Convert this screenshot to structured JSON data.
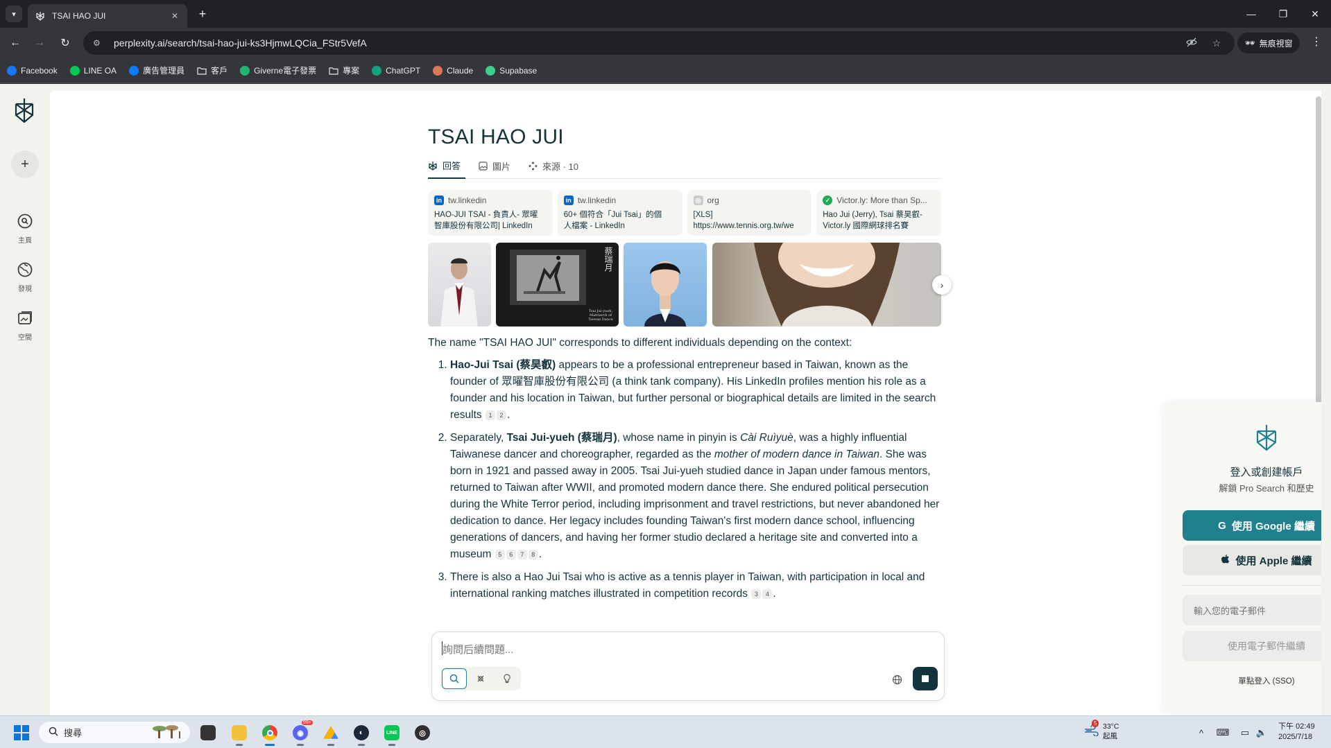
{
  "browser": {
    "tab_title": "TSAI HAO JUI",
    "url": "perplexity.ai/search/tsai-hao-jui-ks3HjmwLQCia_FStr5VefA",
    "profile_label": "無痕視窗",
    "icons": [
      "tab-search-icon",
      "close-icon",
      "new-tab-icon",
      "minimize-icon",
      "restore-icon",
      "back-icon",
      "forward-icon",
      "reload-icon",
      "site-info-icon",
      "eye-off-icon",
      "star-icon",
      "incognito-icon",
      "more-vert-icon"
    ]
  },
  "bookmarks": [
    {
      "label": "Facebook",
      "icon": "facebook-icon",
      "color": "#1877f2"
    },
    {
      "label": "LINE OA",
      "icon": "line-icon",
      "color": "#06c755"
    },
    {
      "label": "廣告管理員",
      "icon": "meta-icon",
      "color": "#0a7cff"
    },
    {
      "label": "客戶",
      "icon": "folder-icon",
      "color": "#e8eaed"
    },
    {
      "label": "Giverne電子發票",
      "icon": "giverne-icon",
      "color": "#21b573"
    },
    {
      "label": "專案",
      "icon": "folder-icon",
      "color": "#e8eaed"
    },
    {
      "label": "ChatGPT",
      "icon": "chatgpt-icon",
      "color": "#10a37f"
    },
    {
      "label": "Claude",
      "icon": "claude-icon",
      "color": "#d97757"
    },
    {
      "label": "Supabase",
      "icon": "supabase-icon",
      "color": "#3ecf8e"
    }
  ],
  "sidebar": {
    "items": [
      {
        "label": "主頁",
        "icon": "search-icon"
      },
      {
        "label": "發現",
        "icon": "globe-icon"
      },
      {
        "label": "空間",
        "icon": "spaces-icon"
      }
    ]
  },
  "page": {
    "title": "TSAI HAO JUI",
    "tabs": [
      {
        "label": "回答",
        "icon": "perplexity-icon"
      },
      {
        "label": "圖片",
        "icon": "image-icon"
      },
      {
        "label": "來源 · 10",
        "icon": "sources-icon"
      }
    ],
    "sources": [
      {
        "domain": "tw.linkedin",
        "title1": "HAO-JUI TSAI - 負責人- 眾曜",
        "title2": "智庫股份有限公司| LinkedIn",
        "icon": "linkedin-icon"
      },
      {
        "domain": "tw.linkedin",
        "title1": "60+ 個符合「Jui Tsai」的個",
        "title2": "人檔案 - LinkedIn",
        "icon": "linkedin-icon"
      },
      {
        "domain": "org",
        "title1": "[XLS]",
        "title2": "https://www.tennis.org.tw/we",
        "icon": "globe-icon"
      },
      {
        "domain": "Victor.ly: More than Sp...",
        "title1": "Hao Jui (Jerry), Tsai 蔡昊叡-",
        "title2": "Victor.ly 國際網球排名賽",
        "icon": "check-icon"
      }
    ],
    "image_caption": "Tsai Jui-yueh, Matriarch of Taiwan Dance",
    "image_calligraphy": "蔡瑞月",
    "answer": {
      "intro": "The name \"TSAI HAO JUI\" corresponds to different individuals depending on the context:",
      "items": [
        {
          "bold": "Hao-Jui Tsai (蔡昊叡)",
          "text": " appears to be a professional entrepreneur based in Taiwan, known as the founder of 眾曜智庫股份有限公司 (a think tank company). His LinkedIn profiles mention his role as a founder and his location in Taiwan, but further personal or biographical details are limited in the search results",
          "cites": [
            "1",
            "2"
          ]
        },
        {
          "pre": "Separately, ",
          "bold": "Tsai Jui-yueh (蔡瑞月)",
          "mid": ", whose name in pinyin is ",
          "italic": "Cài Ruìyuè",
          "mid2": ", was a highly influential Taiwanese dancer and choreographer, regarded as the ",
          "italic2": "mother of modern dance in Taiwan",
          "text": ". She was born in 1921 and passed away in 2005. Tsai Jui-yueh studied dance in Japan under famous mentors, returned to Taiwan after WWII, and promoted modern dance there. She endured political persecution during the White Terror period, including imprisonment and travel restrictions, but never abandoned her dedication to dance. Her legacy includes founding Taiwan's first modern dance school, influencing generations of dancers, and having her former studio declared a heritage site and converted into a museum",
          "cites": [
            "5",
            "6",
            "7",
            "8"
          ]
        },
        {
          "text": "There is also a Hao Jui Tsai who is active as a tennis player in Taiwan, with participation in local and international ranking matches illustrated in competition records",
          "cites": [
            "3",
            "4"
          ]
        }
      ]
    },
    "ask": {
      "placeholder": "詢問后續問題..."
    }
  },
  "login": {
    "heading": "登入或創建帳戶",
    "sub": "解鎖 Pro Search 和歷史",
    "google_label": "使用 Google 繼續",
    "apple_label": "使用 Apple 繼續",
    "email_placeholder": "輸入您的電子郵件",
    "email_button": "使用電子郵件繼續",
    "sso": "單點登入 (SSO)",
    "accent": "#21808d"
  },
  "taskbar": {
    "search_label": "搜尋",
    "weather_temp": "33°C",
    "weather_desc": "起風",
    "weather_badge": "5",
    "discord_badge": "99+",
    "time": "下午 02:49",
    "date": "2025/7/18"
  }
}
